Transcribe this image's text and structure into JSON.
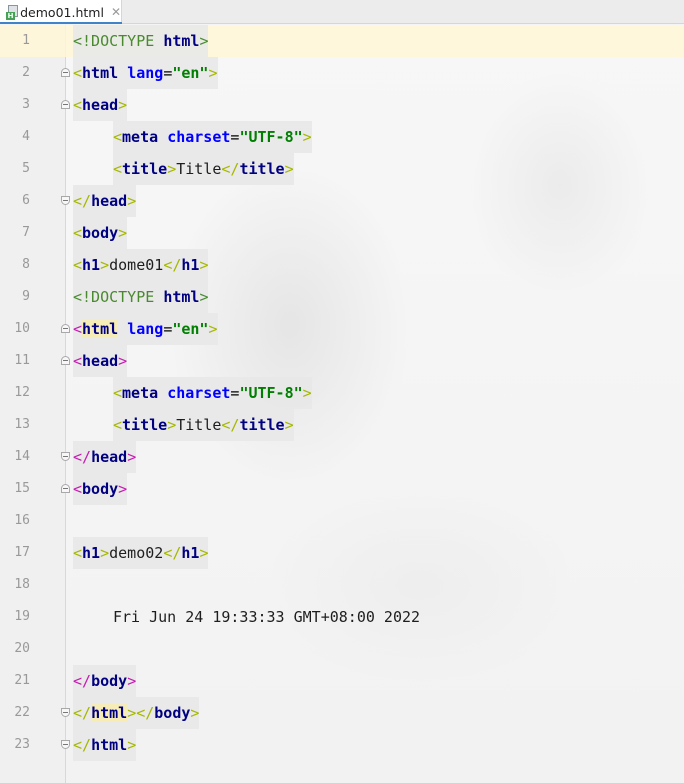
{
  "tab": {
    "filename": "demo01.html",
    "badge": "H",
    "close_glyph": "✕"
  },
  "lines": [
    {
      "n": "1",
      "doctype": "<!DOCTYPE",
      "name": "html",
      "end": ">"
    },
    {
      "n": "2",
      "name": "html",
      "attr": "lang",
      "val": "\"en\""
    },
    {
      "n": "3",
      "name": "head"
    },
    {
      "n": "4",
      "name": "meta",
      "attr": "charset",
      "val": "\"UTF-8\""
    },
    {
      "n": "5",
      "open": "title",
      "text": "Title",
      "close": "title"
    },
    {
      "n": "6",
      "name": "head"
    },
    {
      "n": "7",
      "name": "body"
    },
    {
      "n": "8",
      "open": "h1",
      "text": "dome01",
      "close": "h1"
    },
    {
      "n": "9",
      "doctype": "<!DOCTYPE",
      "name": "html",
      "end": ">"
    },
    {
      "n": "10",
      "name": "html",
      "attr": "lang",
      "val": "\"en\""
    },
    {
      "n": "11",
      "name": "head"
    },
    {
      "n": "12",
      "name": "meta",
      "attr": "charset",
      "val": "\"UTF-8\""
    },
    {
      "n": "13",
      "open": "title",
      "text": "Title",
      "close": "title"
    },
    {
      "n": "14",
      "name": "head"
    },
    {
      "n": "15",
      "name": "body"
    },
    {
      "n": "16"
    },
    {
      "n": "17",
      "open": "h1",
      "text": "demo02",
      "close": "h1"
    },
    {
      "n": "18"
    },
    {
      "n": "19",
      "text": "Fri Jun 24 19:33:33 GMT+08:00 2022"
    },
    {
      "n": "20"
    },
    {
      "n": "21",
      "name": "body"
    },
    {
      "n": "22",
      "name": "html",
      "name2": "body"
    },
    {
      "n": "23",
      "name": "html"
    }
  ],
  "colors": {
    "current_line": "#fff7d6",
    "tag_name": "#000080",
    "bracket": "#a6b800",
    "bracket_alt": "#c41cb0",
    "attribute": "#0000ff",
    "string": "#007f00",
    "doctype": "#4a8a2f",
    "tab_accent": "#4083c9"
  }
}
